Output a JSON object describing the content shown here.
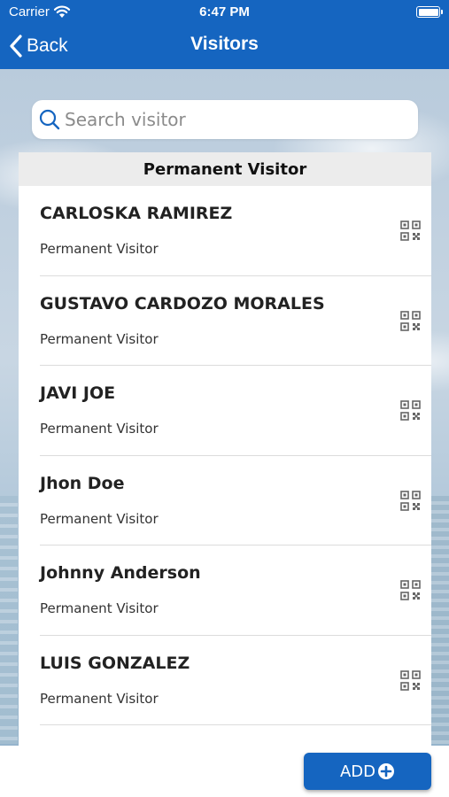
{
  "status_bar": {
    "carrier": "Carrier",
    "time": "6:47 PM"
  },
  "nav": {
    "back_label": "Back",
    "title": "Visitors"
  },
  "search": {
    "placeholder": "Search visitor",
    "value": ""
  },
  "section": {
    "title": "Permanent Visitor"
  },
  "visitors": [
    {
      "name": "CARLOSKA RAMIREZ",
      "type": "Permanent Visitor",
      "icon": "qr-code-icon"
    },
    {
      "name": "GUSTAVO CARDOZO MORALES",
      "type": "Permanent Visitor",
      "icon": "qr-code-icon"
    },
    {
      "name": "JAVI JOE",
      "type": "Permanent Visitor",
      "icon": "qr-code-icon"
    },
    {
      "name": "Jhon Doe",
      "type": "Permanent Visitor",
      "icon": "qr-code-icon"
    },
    {
      "name": "Johnny Anderson",
      "type": "Permanent Visitor",
      "icon": "qr-code-icon"
    },
    {
      "name": "LUIS GONZALEZ",
      "type": "Permanent Visitor",
      "icon": "qr-code-icon"
    }
  ],
  "footer": {
    "add_label": "ADD"
  },
  "colors": {
    "primary": "#1565c0",
    "section_bg": "#ececec"
  }
}
